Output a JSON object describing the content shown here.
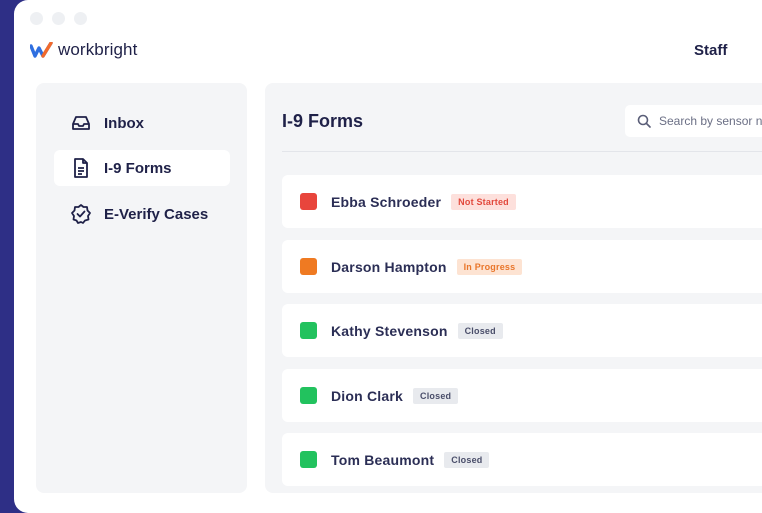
{
  "app": {
    "brand": "workbright",
    "user_menu": "Staff"
  },
  "sidebar": {
    "items": [
      {
        "label": "Inbox",
        "icon": "inbox-icon",
        "active": false
      },
      {
        "label": "I-9 Forms",
        "icon": "document-icon",
        "active": true
      },
      {
        "label": "E-Verify Cases",
        "icon": "verified-badge-icon",
        "active": false
      }
    ]
  },
  "main": {
    "title": "I-9 Forms",
    "search": {
      "placeholder": "Search by sensor n"
    },
    "rows": [
      {
        "name": "Ebba Schroeder",
        "status": "Not Started",
        "color": "#e8453c",
        "badge_style": "red"
      },
      {
        "name": "Darson Hampton",
        "status": "In Progress",
        "color": "#ef7a22",
        "badge_style": "orange"
      },
      {
        "name": "Kathy Stevenson",
        "status": "Closed",
        "color": "#22c25e",
        "badge_style": "gray"
      },
      {
        "name": "Dion Clark",
        "status": "Closed",
        "color": "#22c25e",
        "badge_style": "gray"
      },
      {
        "name": "Tom Beaumont",
        "status": "Closed",
        "color": "#22c25e",
        "badge_style": "gray"
      }
    ]
  },
  "colors": {
    "frame": "#2e2f86",
    "text": "#1f2148",
    "panel": "#f4f5f7"
  }
}
